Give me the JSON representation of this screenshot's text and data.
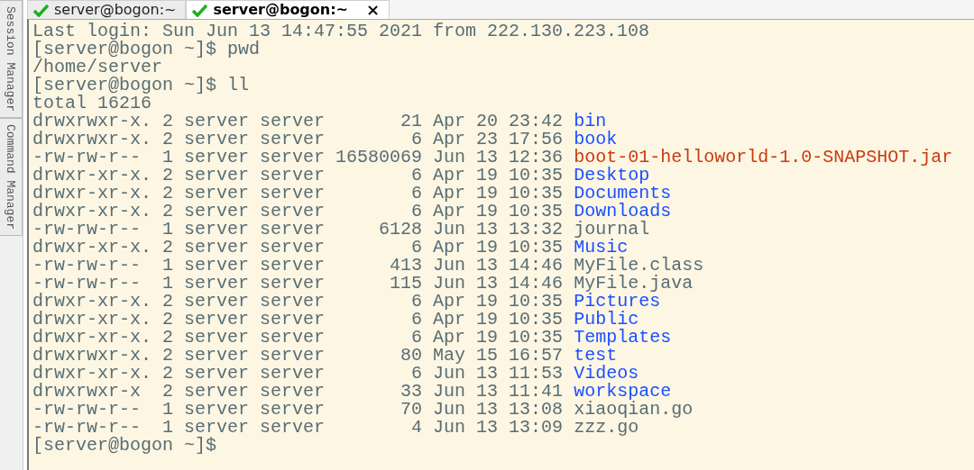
{
  "side_tabs": [
    {
      "label": "Session Manager"
    },
    {
      "label": "Command Manager"
    }
  ],
  "tabs": [
    {
      "label": "server@bogon:~",
      "selected": false
    },
    {
      "label": "server@bogon:~",
      "selected": true,
      "close": "×"
    }
  ],
  "terminal": {
    "lines": [
      {
        "kind": "text",
        "text": "Last login: Sun Jun 13 14:47:55 2021 from 222.130.223.108"
      },
      {
        "kind": "text",
        "text": "[server@bogon ~]$ pwd"
      },
      {
        "kind": "text",
        "text": "/home/server"
      },
      {
        "kind": "text",
        "text": "[server@bogon ~]$ ll"
      },
      {
        "kind": "text",
        "text": "total 16216"
      },
      {
        "kind": "dir",
        "info": "drwxrwxr-x. 2 server server       21 Apr 20 23:42",
        "name": "bin"
      },
      {
        "kind": "dir",
        "info": "drwxrwxr-x. 2 server server        6 Apr 23 17:56",
        "name": "book"
      },
      {
        "kind": "archive",
        "info": "-rw-rw-r--  1 server server 16580069 Jun 13 12:36",
        "name": "boot-01-helloworld-1.0-SNAPSHOT.jar"
      },
      {
        "kind": "dir",
        "info": "drwxr-xr-x. 2 server server        6 Apr 19 10:35",
        "name": "Desktop"
      },
      {
        "kind": "dir",
        "info": "drwxr-xr-x. 2 server server        6 Apr 19 10:35",
        "name": "Documents"
      },
      {
        "kind": "dir",
        "info": "drwxr-xr-x. 2 server server        6 Apr 19 10:35",
        "name": "Downloads"
      },
      {
        "kind": "file",
        "info": "-rw-rw-r--  1 server server     6128 Jun 13 13:32",
        "name": "journal"
      },
      {
        "kind": "dir",
        "info": "drwxr-xr-x. 2 server server        6 Apr 19 10:35",
        "name": "Music"
      },
      {
        "kind": "file",
        "info": "-rw-rw-r--  1 server server      413 Jun 13 14:46",
        "name": "MyFile.class"
      },
      {
        "kind": "file",
        "info": "-rw-rw-r--  1 server server      115 Jun 13 14:46",
        "name": "MyFile.java"
      },
      {
        "kind": "dir",
        "info": "drwxr-xr-x. 2 server server        6 Apr 19 10:35",
        "name": "Pictures"
      },
      {
        "kind": "dir",
        "info": "drwxr-xr-x. 2 server server        6 Apr 19 10:35",
        "name": "Public"
      },
      {
        "kind": "dir",
        "info": "drwxr-xr-x. 2 server server        6 Apr 19 10:35",
        "name": "Templates"
      },
      {
        "kind": "dir",
        "info": "drwxrwxr-x. 2 server server       80 May 15 16:57",
        "name": "test"
      },
      {
        "kind": "dir",
        "info": "drwxr-xr-x. 2 server server        6 Jun 13 11:53",
        "name": "Videos"
      },
      {
        "kind": "dir",
        "info": "drwxrwxr-x  2 server server       33 Jun 13 11:41",
        "name": "workspace"
      },
      {
        "kind": "file",
        "info": "-rw-rw-r--  1 server server       70 Jun 13 13:08",
        "name": "xiaoqian.go"
      },
      {
        "kind": "file",
        "info": "-rw-rw-r--  1 server server        4 Jun 13 13:09",
        "name": "zzz.go"
      },
      {
        "kind": "text",
        "text": "[server@bogon ~]$"
      }
    ]
  }
}
